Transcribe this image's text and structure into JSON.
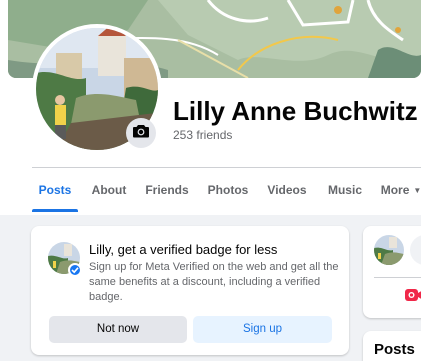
{
  "profile": {
    "name": "Lilly Anne Buchwitz",
    "friends": "253 friends"
  },
  "tabs": [
    {
      "label": "Posts",
      "active": true
    },
    {
      "label": "About"
    },
    {
      "label": "Friends"
    },
    {
      "label": "Photos"
    },
    {
      "label": "Videos"
    },
    {
      "label": "Music"
    },
    {
      "label": "More"
    }
  ],
  "verified_card": {
    "title": "Lilly, get a verified badge for less",
    "body": "Sign up for Meta Verified on the web and get all the same benefits at a discount, including a verified badge.",
    "not_now": "Not now",
    "sign_up": "Sign up"
  },
  "right_column": {
    "posts_title": "Posts"
  },
  "colors": {
    "accent": "#1b74e4",
    "background": "#f0f2f5",
    "live_red": "#f02849"
  },
  "icons": {
    "camera": "camera-icon",
    "caret": "caret-down-icon",
    "verified": "verified-check-icon",
    "live": "live-video-icon"
  }
}
